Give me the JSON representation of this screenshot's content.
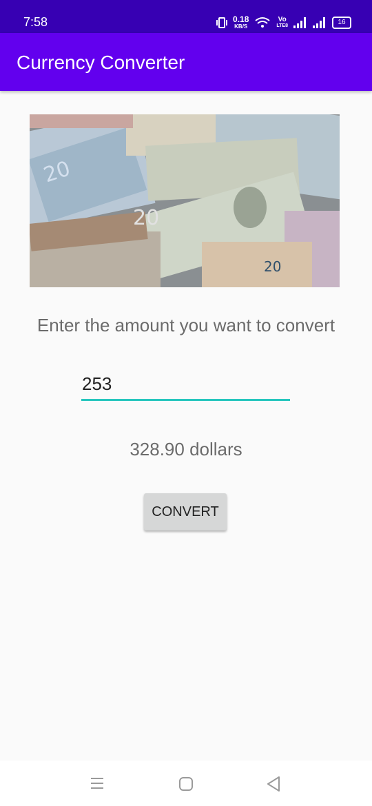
{
  "status_bar": {
    "time": "7:58",
    "net_speed_value": "0.18",
    "net_speed_unit": "KB/S",
    "volte_top": "Vo",
    "volte_bottom": "LTE8",
    "battery": "16"
  },
  "app_bar": {
    "title": "Currency Converter"
  },
  "main": {
    "image_icon": "banknotes-photo",
    "prompt": "Enter the amount you want to convert",
    "amount_value": "253",
    "result": "328.90 dollars",
    "convert_label": "CONVERT"
  },
  "colors": {
    "status_bar": "#3700b3",
    "app_bar": "#6200ee",
    "input_underline": "#26c6bd",
    "button_bg": "#d6d7d7"
  },
  "nav_bar": {
    "icons": [
      "recents-icon",
      "home-icon",
      "back-icon"
    ]
  }
}
